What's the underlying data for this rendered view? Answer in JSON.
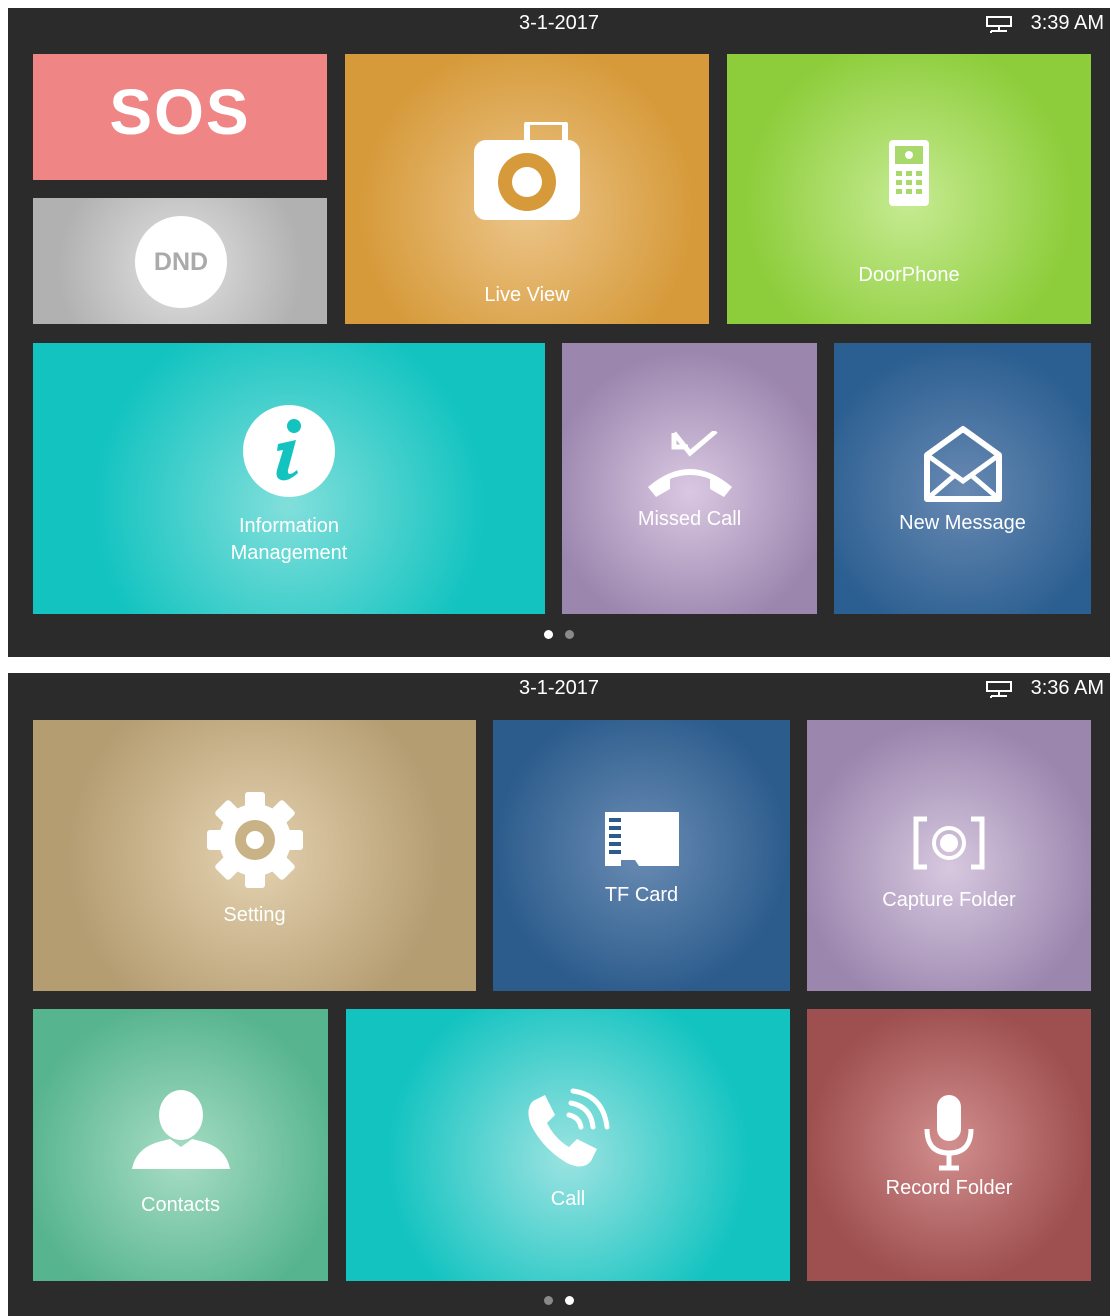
{
  "screen1": {
    "status": {
      "date": "3-1-2017",
      "time": "3:39 AM"
    },
    "tiles": {
      "sos": {
        "label": "SOS",
        "color": "#ef8585"
      },
      "dnd": {
        "label": "DND",
        "color": "#b1b1b1"
      },
      "live_view": {
        "label": "Live View",
        "icon": "camera-icon",
        "color": "#d69a3a"
      },
      "doorphone": {
        "label": "DoorPhone",
        "icon": "doorphone-icon",
        "color": "#8dcd3b"
      },
      "information": {
        "line1": "Information",
        "line2": "Management",
        "icon": "info-icon",
        "color": "#12c3c0"
      },
      "missed_call": {
        "label": "Missed Call",
        "icon": "missed-call-icon",
        "color": "#9b86ae"
      },
      "new_message": {
        "label": "New Message",
        "icon": "envelope-icon",
        "color": "#2b5f91"
      }
    },
    "pagination": {
      "current": 1,
      "total": 2
    }
  },
  "screen2": {
    "status": {
      "date": "3-1-2017",
      "time": "3:36 AM"
    },
    "tiles": {
      "setting": {
        "label": "Setting",
        "icon": "gear-icon",
        "color": "#b59d72"
      },
      "tf_card": {
        "label": "TF Card",
        "icon": "sd-card-icon",
        "color": "#2c5c8c"
      },
      "capture_folder": {
        "label": "Capture Folder",
        "icon": "capture-icon",
        "color": "#9b86ae"
      },
      "contacts": {
        "label": "Contacts",
        "icon": "person-icon",
        "color": "#56b48e"
      },
      "call": {
        "label": "Call",
        "icon": "phone-icon",
        "color": "#12c3c0"
      },
      "record_folder": {
        "label": "Record Folder",
        "icon": "microphone-icon",
        "color": "#9e4f4f"
      }
    },
    "pagination": {
      "current": 2,
      "total": 2
    }
  }
}
